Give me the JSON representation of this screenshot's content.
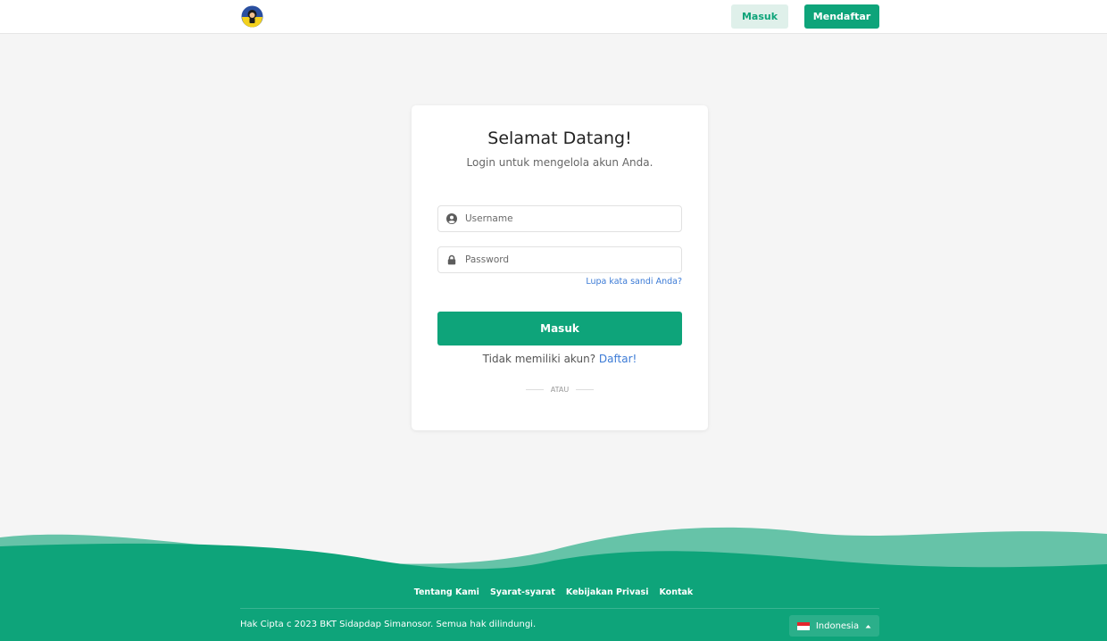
{
  "header": {
    "login_label": "Masuk",
    "register_label": "Mendaftar"
  },
  "login_card": {
    "title": "Selamat Datang!",
    "subtitle": "Login untuk mengelola akun Anda.",
    "username_placeholder": "Username",
    "password_placeholder": "Password",
    "forgot_label": "Lupa kata sandi Anda?",
    "submit_label": "Masuk",
    "no_account_text": "Tidak memiliki akun?",
    "register_link": "Daftar!",
    "divider_text": "ATAU"
  },
  "footer": {
    "links": [
      "Tentang Kami",
      "Syarat-syarat",
      "Kebijakan Privasi",
      "Kontak"
    ],
    "copyright": "Hak Cipta c 2023 BKT Sidapdap Simanosor. Semua hak dilindungi.",
    "language": "Indonesia"
  },
  "colors": {
    "primary": "#0ea47a",
    "primary_light": "#dff0ea",
    "wave_light": "#66c3a8",
    "link": "#3c7bd6"
  },
  "icons": {
    "logo": "logo-icon",
    "username": "user-circle-icon",
    "password": "lock-icon",
    "language_flag": "indonesia-flag-icon",
    "language_caret": "caret-up-icon"
  }
}
